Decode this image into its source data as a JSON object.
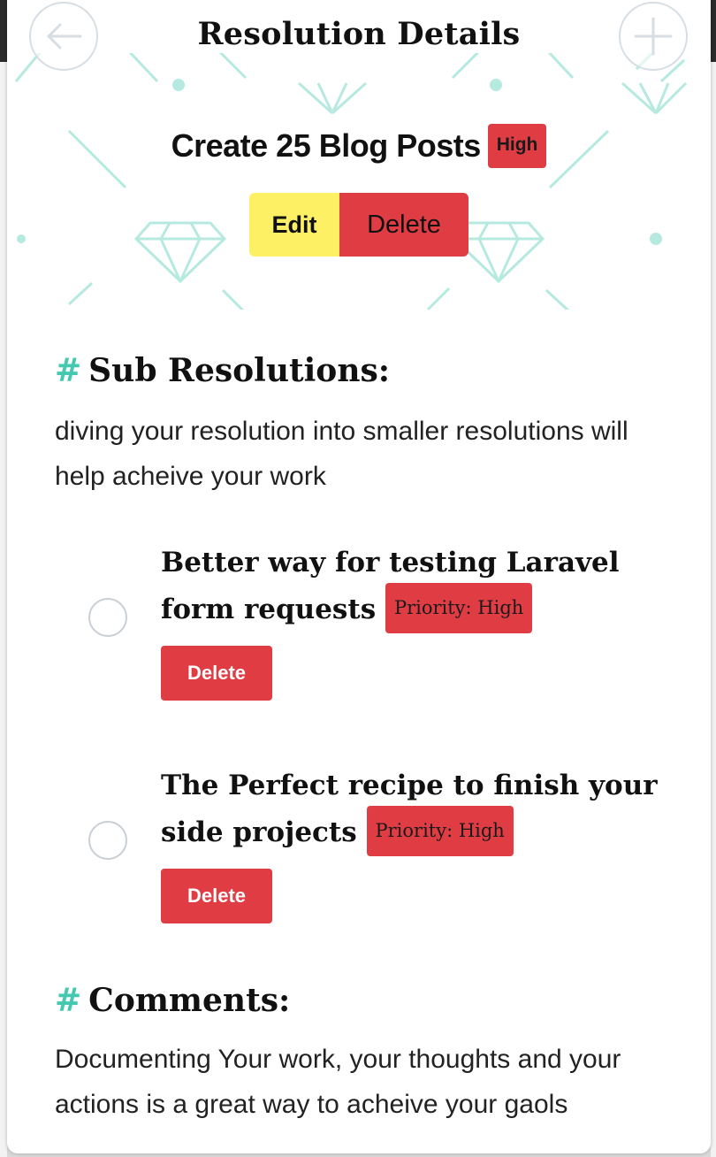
{
  "header": {
    "title": "Resolution Details",
    "back_icon": "arrow-left-icon",
    "add_icon": "plus-icon"
  },
  "resolution": {
    "title": "Create 25 Blog Posts",
    "priority_badge": "High",
    "edit_label": "Edit",
    "delete_label": "Delete"
  },
  "sub_resolutions": {
    "hash": "#",
    "heading": "Sub Resolutions:",
    "description": "diving your resolution into smaller resolutions will help acheive your work",
    "items": [
      {
        "title": "Better way for testing Laravel form requests",
        "priority": "Priority: High",
        "delete_label": "Delete"
      },
      {
        "title": "The Perfect recipe to finish your side projects",
        "priority": "Priority: High",
        "delete_label": "Delete"
      }
    ]
  },
  "comments": {
    "hash": "#",
    "heading": "Comments:",
    "description": "Documenting Your work, your thoughts and your actions is a great way to acheive your gaols"
  },
  "colors": {
    "accent": "#43c9b0",
    "danger": "#e03c44",
    "edit": "#fdf064",
    "pattern": "#b6e9df"
  }
}
